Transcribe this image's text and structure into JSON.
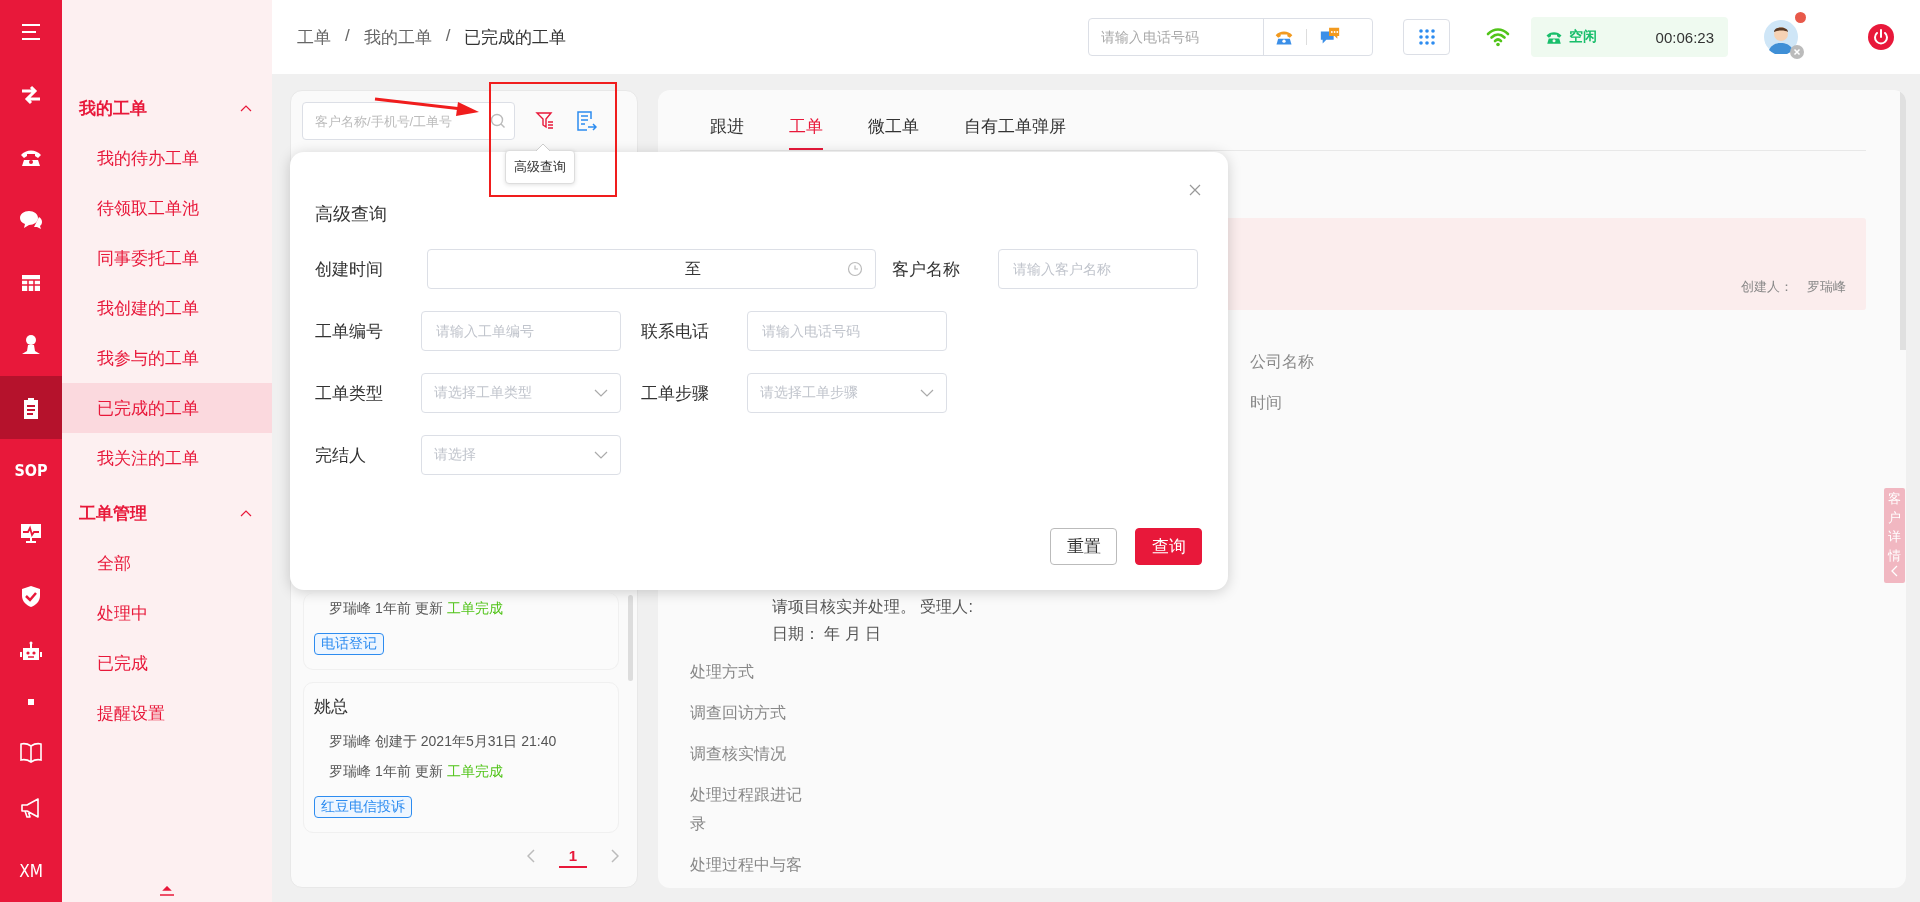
{
  "rail": {
    "items": [
      {
        "kind": "icon",
        "selected": false
      },
      {
        "kind": "icon",
        "selected": false
      },
      {
        "kind": "icon",
        "selected": false
      },
      {
        "kind": "icon",
        "selected": false
      },
      {
        "kind": "icon",
        "selected": false
      },
      {
        "kind": "icon",
        "selected": true
      },
      {
        "kind": "text",
        "label": "SOP",
        "selected": false
      },
      {
        "kind": "icon",
        "selected": false
      },
      {
        "kind": "icon",
        "selected": false
      },
      {
        "kind": "icon",
        "selected": false
      },
      {
        "kind": "icon",
        "selected": false
      },
      {
        "kind": "icon",
        "selected": false
      },
      {
        "kind": "icon",
        "selected": false
      },
      {
        "kind": "text",
        "label": "XM",
        "selected": false
      }
    ]
  },
  "sidebar": {
    "groups": [
      {
        "title": "我的工单",
        "expanded": true,
        "items": [
          {
            "label": "我的待办工单",
            "selected": false
          },
          {
            "label": "待领取工单池",
            "selected": false
          },
          {
            "label": "同事委托工单",
            "selected": false
          },
          {
            "label": "我创建的工单",
            "selected": false
          },
          {
            "label": "我参与的工单",
            "selected": false
          },
          {
            "label": "已完成的工单",
            "selected": true
          },
          {
            "label": "我关注的工单",
            "selected": false
          }
        ]
      },
      {
        "title": "工单管理",
        "expanded": true,
        "items": [
          {
            "label": "全部",
            "selected": false
          },
          {
            "label": "处理中",
            "selected": false
          },
          {
            "label": "已完成",
            "selected": false
          },
          {
            "label": "提醒设置",
            "selected": false
          }
        ]
      }
    ]
  },
  "header": {
    "breadcrumb": [
      "工单",
      "我的工单",
      "已完成的工单"
    ],
    "separator": "/",
    "phone": {
      "placeholder": "请输入电话号码"
    },
    "status": {
      "label": "空闲",
      "timer": "00:06:23"
    }
  },
  "list": {
    "search": {
      "placeholder": "客户名称/手机号/工单号"
    },
    "tooltip": "高级查询",
    "cards": [
      {
        "updated": "罗瑞峰 1年前 更新",
        "status": "工单完成",
        "tag": "电话登记"
      },
      {
        "title": "姚总",
        "created": "罗瑞峰 创建于 2021年5月31日 21:40",
        "updated": "罗瑞峰 1年前 更新",
        "status": "工单完成",
        "tag": "红豆电信投诉"
      }
    ],
    "pagination": [
      {
        "label": "1",
        "selected": true
      }
    ]
  },
  "detail": {
    "tabs": [
      {
        "label": "跟进",
        "selected": false
      },
      {
        "label": "工单",
        "selected": true
      },
      {
        "label": "微工单",
        "selected": false
      },
      {
        "label": "自有工单弹屏",
        "selected": false
      }
    ],
    "banner": {
      "creator_label": "创建人：",
      "creator": "罗瑞峰"
    },
    "right_fields": [
      "公司名称",
      "时间"
    ],
    "note": [
      "请项目核实并处理。 受理人:",
      "日期：  年 月 日"
    ],
    "labels": [
      "处理方式",
      "调查回访方式",
      "调查核实情况",
      "处理过程跟进记录",
      "处理过程中与客"
    ],
    "side_tab": "客户详情"
  },
  "dialog": {
    "title": "高级查询",
    "rows": [
      [
        {
          "label": "创建时间",
          "kind": "daterange",
          "separator": "至"
        },
        {
          "label": "客户名称",
          "kind": "text",
          "placeholder": "请输入客户名称"
        }
      ],
      [
        {
          "label": "工单编号",
          "kind": "text",
          "placeholder": "请输入工单编号"
        },
        {
          "label": "联系电话",
          "kind": "text",
          "placeholder": "请输入电话号码"
        }
      ],
      [
        {
          "label": "工单类型",
          "kind": "select",
          "placeholder": "请选择工单类型"
        },
        {
          "label": "工单步骤",
          "kind": "select",
          "placeholder": "请选择工单步骤"
        }
      ],
      [
        {
          "label": "完结人",
          "kind": "select",
          "placeholder": "请选择"
        }
      ]
    ],
    "buttons": [
      {
        "label": "重置",
        "kind": "secondary"
      },
      {
        "label": "查询",
        "kind": "primary"
      }
    ]
  }
}
